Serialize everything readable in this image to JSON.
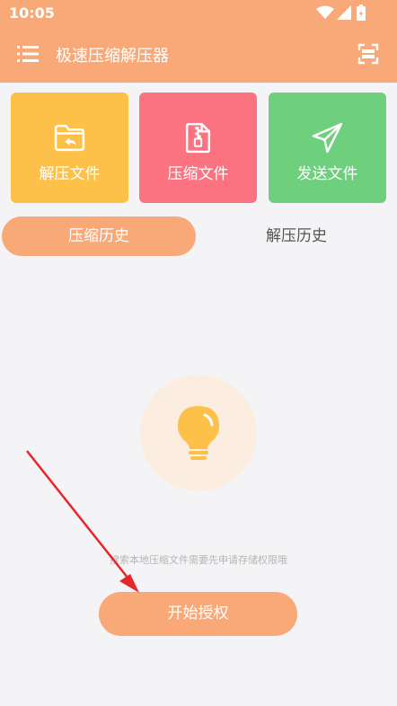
{
  "status_bar": {
    "time": "10:05"
  },
  "app_bar": {
    "title": "极速压缩解压器",
    "menu_icon": "menu-icon",
    "scan_icon": "scan-icon"
  },
  "cards": [
    {
      "label": "解压文件",
      "icon": "folder-undo-icon",
      "color": "#fdc149"
    },
    {
      "label": "压缩文件",
      "icon": "zip-file-icon",
      "color": "#fb7281"
    },
    {
      "label": "发送文件",
      "icon": "paper-plane-icon",
      "color": "#6ecf7c"
    }
  ],
  "tabs": [
    {
      "label": "压缩历史",
      "active": true
    },
    {
      "label": "解压历史",
      "active": false
    }
  ],
  "empty_state": {
    "icon": "lightbulb-icon",
    "hint": "搜索本地压缩文件需要先申请存储权限哦"
  },
  "auth_button": {
    "label": "开始授权"
  },
  "colors": {
    "accent": "#f9a978",
    "background": "#f4f4f6",
    "annotation_arrow": "#e8262a"
  }
}
